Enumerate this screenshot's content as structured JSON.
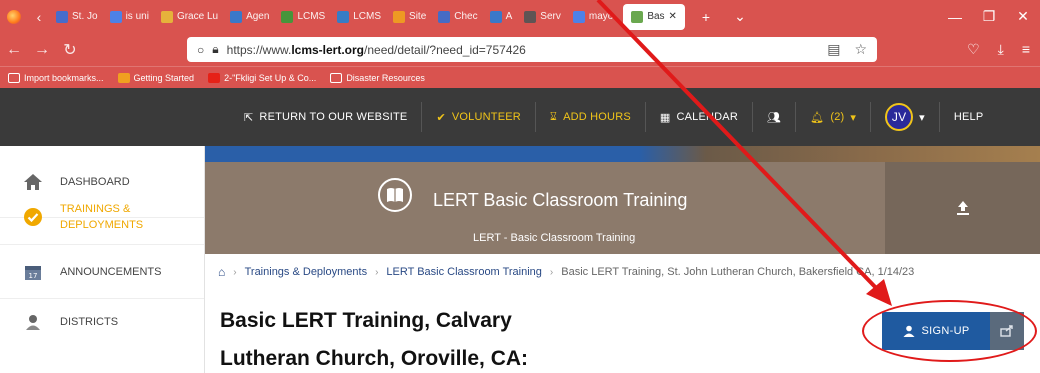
{
  "browser": {
    "tabs": [
      {
        "label": "St. Jo",
        "color": "#3b6fd6"
      },
      {
        "label": "is uni",
        "color": "#4285f4"
      },
      {
        "label": "Grace Lu",
        "color": "#e8bb3a"
      },
      {
        "label": "Agen",
        "color": "#2d7cd4"
      },
      {
        "label": "LCMS",
        "color": "#3a9b3a"
      },
      {
        "label": "LCMS",
        "color": "#2a80d0"
      },
      {
        "label": "Site",
        "color": "#f0a020"
      },
      {
        "label": "Chec",
        "color": "#3a6ed0"
      },
      {
        "label": "A",
        "color": "#2d7cd4"
      },
      {
        "label": "Serv",
        "color": "#555555"
      },
      {
        "label": "mayo",
        "color": "#4285f4"
      }
    ],
    "active_tab": {
      "label": "Bas",
      "color": "#6aa84f"
    },
    "new_tab_symbol": "+",
    "url_prefix": "https://www.",
    "url_domain": "lcms-lert.org",
    "url_path": "/need/detail/?need_id=757426",
    "bookmarks": [
      {
        "label": "Import bookmarks...",
        "color": "#ffffff"
      },
      {
        "label": "Getting Started",
        "color": "#f0a020"
      },
      {
        "label": "2-\"Fkligi Set Up & Co...",
        "color": "#e62117"
      },
      {
        "label": "Disaster Resources",
        "color": "#ffffff"
      }
    ]
  },
  "site_nav": {
    "return_label": "RETURN TO OUR WEBSITE",
    "volunteer_label": "VOLUNTEER",
    "add_hours_label": "ADD HOURS",
    "calendar_label": "CALENDAR",
    "alerts_label": "(2)",
    "avatar_initials": "JV",
    "help_label": "HELP"
  },
  "sidebar": {
    "items": [
      {
        "label": "DASHBOARD",
        "active": false
      },
      {
        "label": "TRAININGS &",
        "label2": "DEPLOYMENTS",
        "active": true
      },
      {
        "label": "ANNOUNCEMENTS",
        "active": false
      },
      {
        "label": "DISTRICTS",
        "active": false
      }
    ]
  },
  "banner": {
    "title": "LERT Basic Classroom Training",
    "subtitle": "LERT - Basic Classroom Training"
  },
  "breadcrumb": {
    "items": [
      "Trainings & Deployments",
      "LERT Basic Classroom Training",
      "Basic LERT Training, St. John Lutheran Church, Bakersfield CA, 1/14/23"
    ]
  },
  "main": {
    "title_line1": "Basic LERT Training, Calvary",
    "title_line2": "Lutheran Church, Oroville, CA:"
  },
  "actions": {
    "signup_label": "SIGN-UP"
  },
  "colors": {
    "browser_chrome": "#d9534f",
    "site_nav": "#3a3a3a",
    "accent_yellow": "#f0c419",
    "signup_blue": "#1f5aa0",
    "annotation_red": "#e01a1a"
  }
}
